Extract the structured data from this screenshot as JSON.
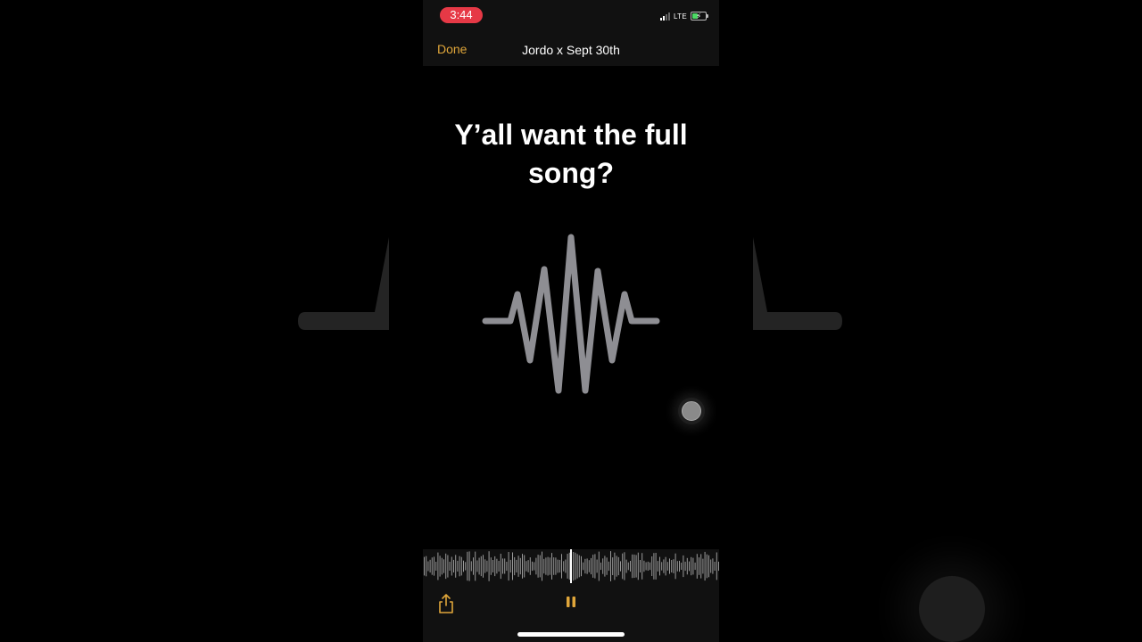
{
  "status_bar": {
    "time": "3:44",
    "network": "LTE",
    "time_pill_color": "#e63946",
    "battery_icon": "battery-charging-icon",
    "signal_icon": "signal-bars-icon"
  },
  "nav": {
    "done_label": "Done",
    "title": "Jordo x Sept 30th"
  },
  "caption": {
    "text": "Y’all want the full song?"
  },
  "player": {
    "share_icon": "share-icon",
    "pause_icon": "pause-icon",
    "accent_color": "#e0a63a"
  },
  "center_icon": "audio-waveform-icon"
}
